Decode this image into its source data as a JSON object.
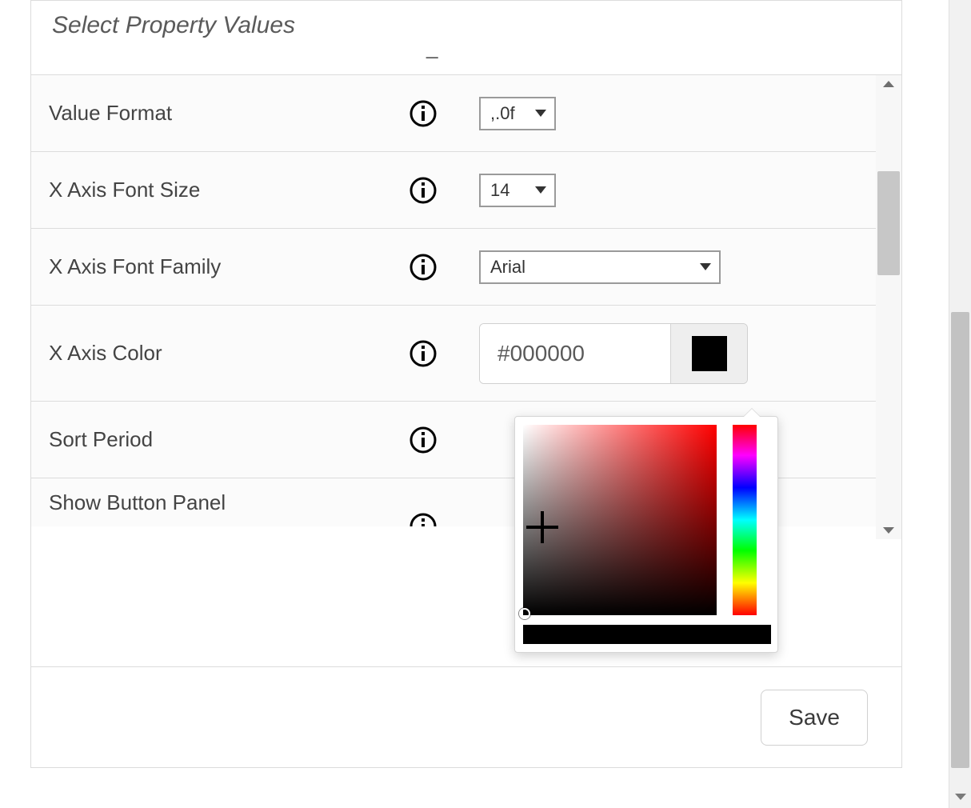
{
  "section": {
    "title": "Select Property Values"
  },
  "properties": {
    "value_format": {
      "label": "Value Format",
      "selected": ",.0f"
    },
    "x_axis_font_size": {
      "label": "X Axis Font Size",
      "selected": "14"
    },
    "x_axis_font_family": {
      "label": "X Axis Font Family",
      "selected": "Arial"
    },
    "x_axis_color": {
      "label": "X Axis Color",
      "hex": "#000000",
      "swatch": "#000000"
    },
    "sort_period": {
      "label": "Sort Period"
    },
    "show_button_panel": {
      "label": "Show Button Panel"
    }
  },
  "color_picker": {
    "preview": "#000000"
  },
  "footer": {
    "save_label": "Save"
  }
}
